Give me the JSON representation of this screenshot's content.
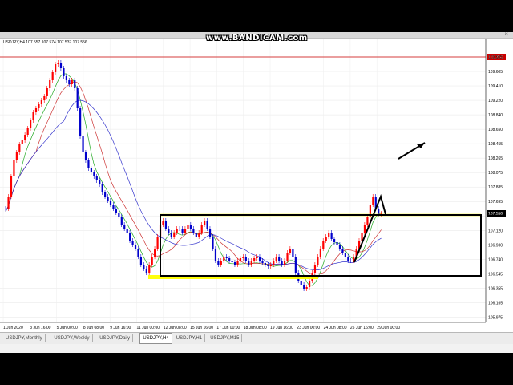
{
  "watermark": "www.BANDICAM.com",
  "chart": {
    "symbol_line": "USDJPY,H4  107.557 107.574 107.537 107.556",
    "current_price": "107.556",
    "red_level": "109.786",
    "price_ticks": [
      "109.985",
      "109.605",
      "109.410",
      "109.220",
      "108.840",
      "108.650",
      "108.455",
      "108.265",
      "108.075",
      "107.885",
      "107.695",
      "107.310",
      "107.120",
      "106.930",
      "106.740",
      "106.545",
      "106.355",
      "106.165",
      "105.975"
    ],
    "time_ticks": [
      "1 Jun 2020",
      "3 Jun 16:00",
      "5 Jun 00:00",
      "8 Jun 08:00",
      "9 Jun 16:00",
      "11 Jun 00:00",
      "12 Jun 08:00",
      "15 Jun 16:00",
      "17 Jun 00:00",
      "18 Jun 08:00",
      "19 Jun 16:00",
      "23 Jun 00:00",
      "24 Jun 08:00",
      "25 Jun 16:00",
      "29 Jun 00:00"
    ],
    "colors": {
      "bull": "#ff0000",
      "bear": "#0000cc",
      "ma_fast": "#22aa22",
      "ma_mid": "#cc3333",
      "ma_slow": "#3333cc",
      "zone": "#ffff00",
      "box": "#000000",
      "red_level": "#cc0000"
    }
  },
  "tabs": [
    {
      "label": "USDJPY,Monthly",
      "active": false
    },
    {
      "label": "USDJPY,Weekly",
      "active": false
    },
    {
      "label": "USDJPY,Daily",
      "active": false
    },
    {
      "label": "USDJPY,H4",
      "active": true
    },
    {
      "label": "USDJPY,H1",
      "active": false
    },
    {
      "label": "USDJPY,M15",
      "active": false
    }
  ],
  "close_symbol": "×"
}
